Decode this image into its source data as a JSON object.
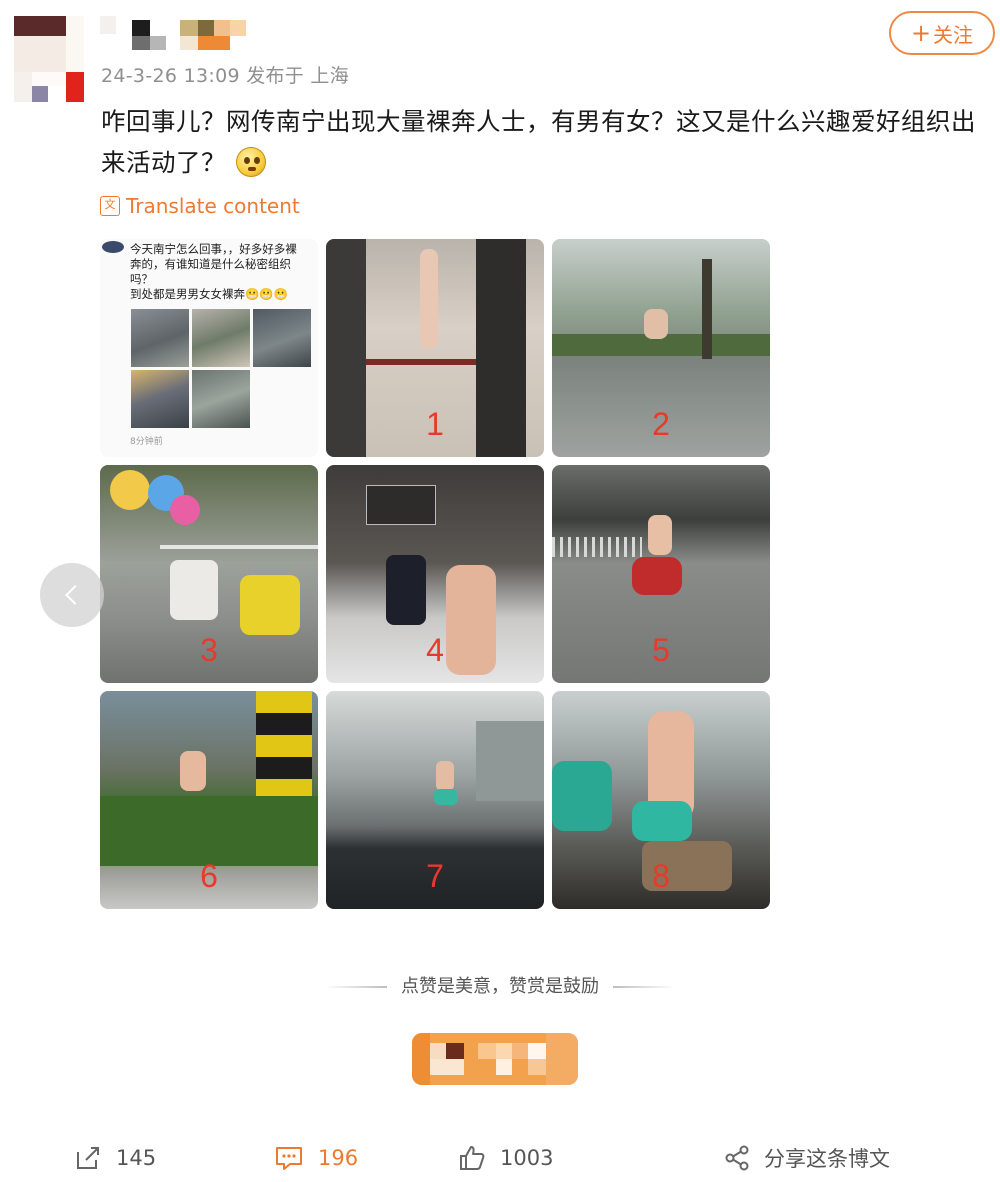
{
  "post": {
    "meta": "24-3-26 13:09 发布于 上海",
    "text": "咋回事儿？网传南宁出现大量裸奔人士，有男有女？这又是什么兴趣爱好组织出来活动了？",
    "translate_label": "Translate content"
  },
  "header": {
    "follow_label": "关注",
    "follow_plus": "+"
  },
  "screenshot_cell": {
    "lines": [
      "今天南宁怎么回事，，好多好多裸",
      "奔的，有谁知道是什么秘密组织",
      "吗？",
      "到处都是男男女女裸奔😬😬😬"
    ],
    "time": "8分钟前"
  },
  "images": [
    {
      "num": "1"
    },
    {
      "num": "2"
    },
    {
      "num": "3"
    },
    {
      "num": "4"
    },
    {
      "num": "5"
    },
    {
      "num": "6"
    },
    {
      "num": "7"
    },
    {
      "num": "8"
    }
  ],
  "reward": {
    "text": "点赞是美意，赞赏是鼓励"
  },
  "actions": {
    "repost": "145",
    "comment": "196",
    "like": "1003",
    "share": "分享这条博文"
  },
  "colors": {
    "accent": "#ee7a2f",
    "number_red": "#e8392b"
  }
}
